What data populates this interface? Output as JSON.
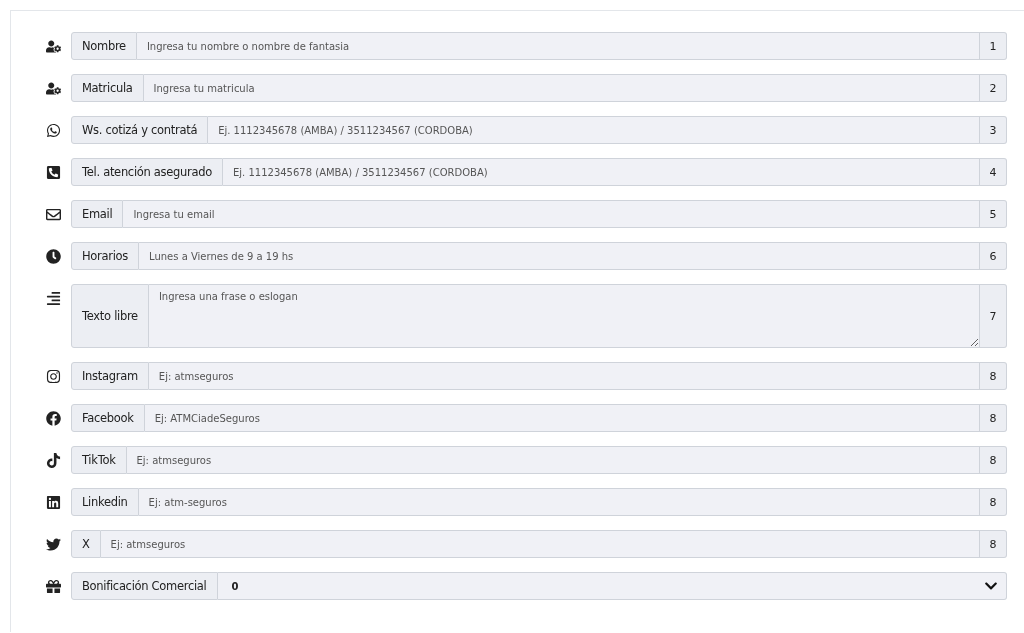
{
  "fields": [
    {
      "kind": "input",
      "label": "Nombre",
      "placeholder": "Ingresa tu nombre o nombre de fantasia",
      "addon": "1"
    },
    {
      "kind": "input",
      "label": "Matricula",
      "placeholder": "Ingresa tu matricula",
      "addon": "2"
    },
    {
      "kind": "input",
      "label": "Ws. cotizá y contratá",
      "placeholder": "Ej. 1112345678 (AMBA) / 3511234567 (CORDOBA)",
      "addon": "3"
    },
    {
      "kind": "input",
      "label": "Tel. atención asegurado",
      "placeholder": "Ej. 1112345678 (AMBA) / 3511234567 (CORDOBA)",
      "addon": "4"
    },
    {
      "kind": "input",
      "label": "Email",
      "placeholder": "Ingresa tu email",
      "addon": "5"
    },
    {
      "kind": "input",
      "label": "Horarios",
      "placeholder": "Lunes a Viernes de 9 a 19 hs",
      "addon": "6"
    },
    {
      "kind": "textarea",
      "label": "Texto libre",
      "placeholder": "Ingresa una frase o eslogan",
      "addon": "7"
    },
    {
      "kind": "input",
      "label": "Instagram",
      "placeholder": "Ej: atmseguros",
      "addon": "8"
    },
    {
      "kind": "input",
      "label": "Facebook",
      "placeholder": "Ej: ATMCiadeSeguros",
      "addon": "8"
    },
    {
      "kind": "input",
      "label": "TikTok",
      "placeholder": "Ej: atmseguros",
      "addon": "8"
    },
    {
      "kind": "input",
      "label": "Linkedin",
      "placeholder": "Ej: atm-seguros",
      "addon": "8"
    },
    {
      "kind": "input",
      "label": "X",
      "placeholder": "Ej: atmseguros",
      "addon": "8"
    },
    {
      "kind": "select",
      "label": "Bonificación Comercial",
      "value": "0"
    }
  ]
}
